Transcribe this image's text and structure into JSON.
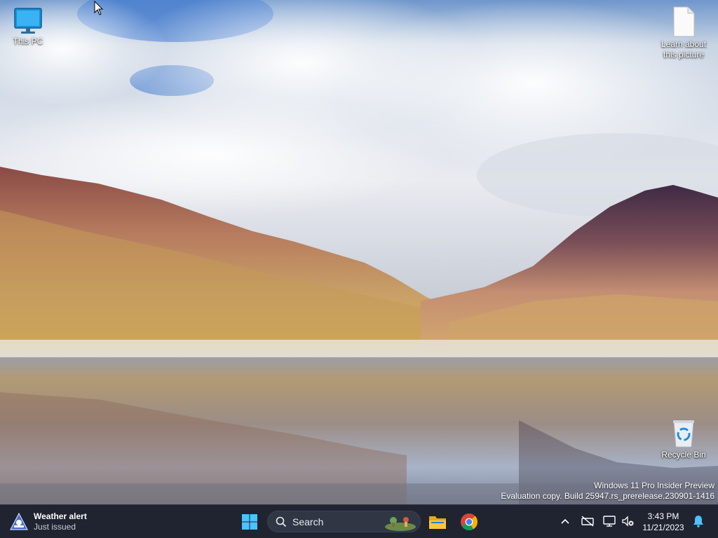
{
  "desktop": {
    "icons": {
      "this_pc": "This PC",
      "learn_picture": "Learn about this picture",
      "recycle_bin": "Recycle Bin"
    },
    "watermark": {
      "line1": "Windows 11 Pro Insider Preview",
      "line2": "Evaluation copy. Build 25947.rs_prerelease.230901-1416"
    }
  },
  "taskbar": {
    "weather": {
      "title": "Weather alert",
      "subtitle": "Just issued",
      "icon": "weather-alert-icon"
    },
    "start_icon": "windows-logo-icon",
    "search": {
      "label": "Search"
    },
    "pinned": [
      "file-explorer-icon",
      "chrome-icon"
    ],
    "tray": {
      "icons": [
        "chevron-up-icon",
        "network-off-icon",
        "display-icon",
        "volume-muted-icon",
        "notification-bell-icon"
      ],
      "time": "3:43 PM",
      "date": "11/21/2023"
    }
  },
  "colors": {
    "taskbar": "#1f2430",
    "accent": "#4cc2ff"
  }
}
